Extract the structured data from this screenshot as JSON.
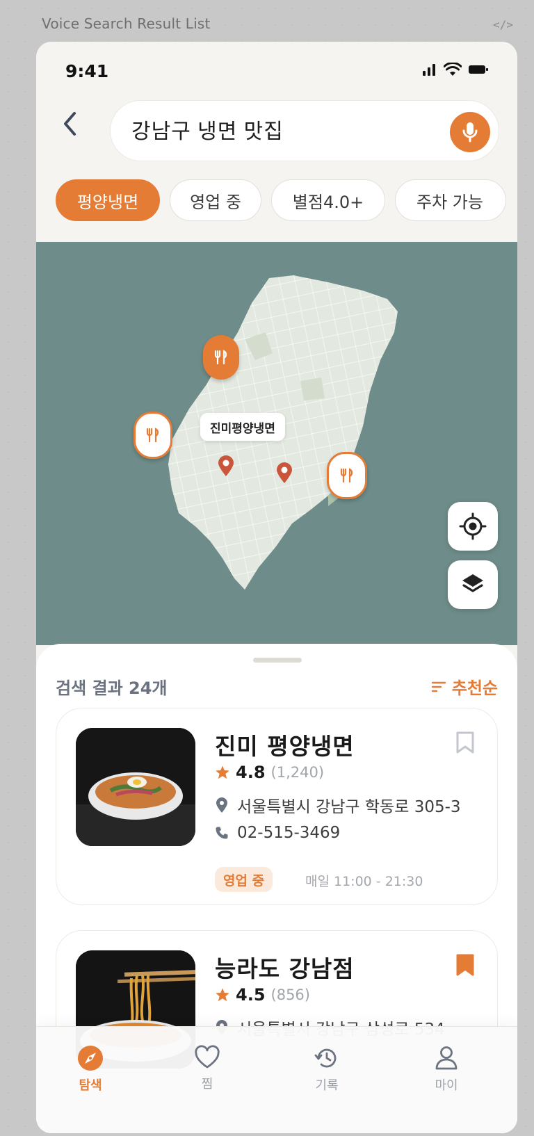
{
  "frame": {
    "title": "Voice Search Result List",
    "code_icon": "</>"
  },
  "status": {
    "time": "9:41"
  },
  "search": {
    "query": "강남구 냉면 맛집"
  },
  "chips": [
    {
      "label": "평양냉면",
      "active": true
    },
    {
      "label": "영업 중",
      "active": false
    },
    {
      "label": "별점4.0+",
      "active": false
    },
    {
      "label": "주차 가능",
      "active": false
    }
  ],
  "map": {
    "selected_label": "진미평양냉면"
  },
  "sheet": {
    "result_count": "검색 결과 24개",
    "sort_label": "추천순"
  },
  "results": [
    {
      "name": "진미 평양냉면",
      "rating": "4.8",
      "reviews": "(1,240)",
      "address": "서울특별시 강남구 학동로 305-3",
      "phone": "02-515-3469",
      "status": "영업 중",
      "hours": "매일 11:00 - 21:30",
      "bookmarked": false
    },
    {
      "name": "능라도 강남점",
      "rating": "4.5",
      "reviews": "(856)",
      "address": "서울특별시 강남구 삼성로 534",
      "bookmarked": true
    }
  ],
  "tabs": [
    {
      "label": "탐색",
      "icon": "compass-icon",
      "active": true
    },
    {
      "label": "찜",
      "icon": "heart-icon",
      "active": false
    },
    {
      "label": "기록",
      "icon": "history-icon",
      "active": false
    },
    {
      "label": "마이",
      "icon": "user-icon",
      "active": false
    }
  ],
  "colors": {
    "accent": "#e47c36",
    "map_water": "#6e8c89",
    "map_land": "#e6ebe3"
  }
}
